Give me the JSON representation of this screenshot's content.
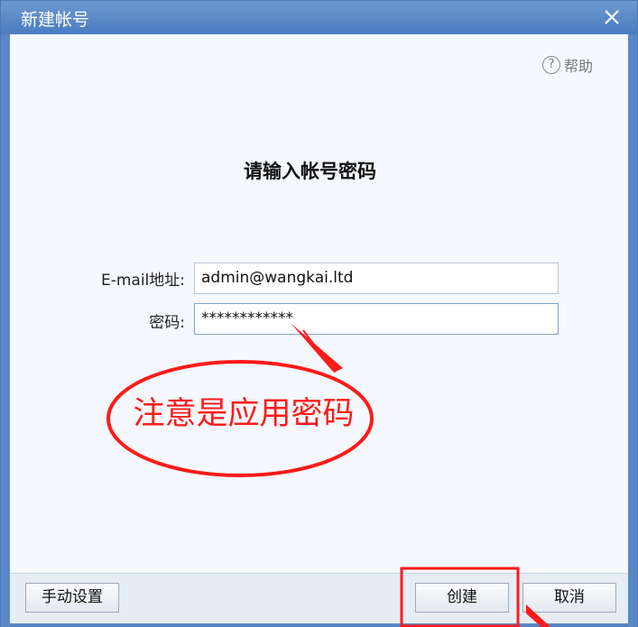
{
  "window": {
    "title": "新建帐号"
  },
  "help": {
    "label": "帮助",
    "icon_glyph": "?"
  },
  "form": {
    "heading": "请输入帐号密码",
    "email_label": "E-mail地址:",
    "email_value": "admin@wangkai.ltd",
    "password_label": "密码:",
    "password_value": "************"
  },
  "annotation": {
    "note": "注意是应用密码",
    "color": "#ff1a1a"
  },
  "footer": {
    "manual_label": "手动设置",
    "create_label": "创建",
    "cancel_label": "取消"
  },
  "colors": {
    "titlebar": "#5a88c6",
    "content_bg": "#f5f8fc",
    "footer_bg": "#e7edf5"
  }
}
